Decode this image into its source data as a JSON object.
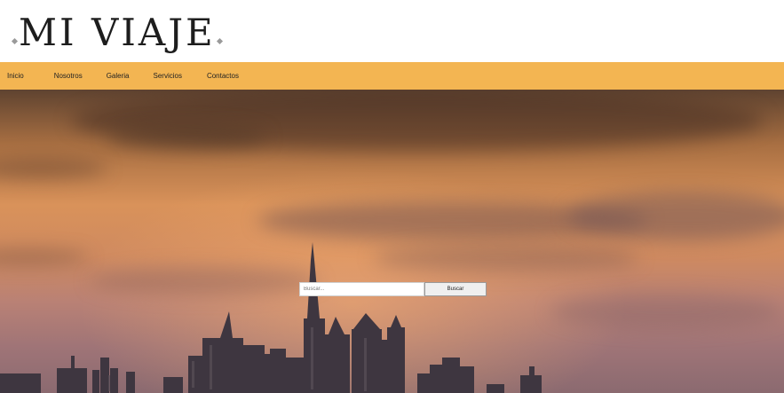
{
  "header": {
    "logo_text": "MI VIAJE"
  },
  "nav": {
    "items": [
      {
        "label": "Inicio"
      },
      {
        "label": "Nosotros"
      },
      {
        "label": "Galeria"
      },
      {
        "label": "Servicios"
      },
      {
        "label": "Contactos"
      }
    ]
  },
  "search": {
    "placeholder": "Buscar...",
    "value": "",
    "button_label": "Buscar"
  },
  "colors": {
    "nav_background": "#f3b552",
    "logo_text": "#1d1d1d"
  }
}
